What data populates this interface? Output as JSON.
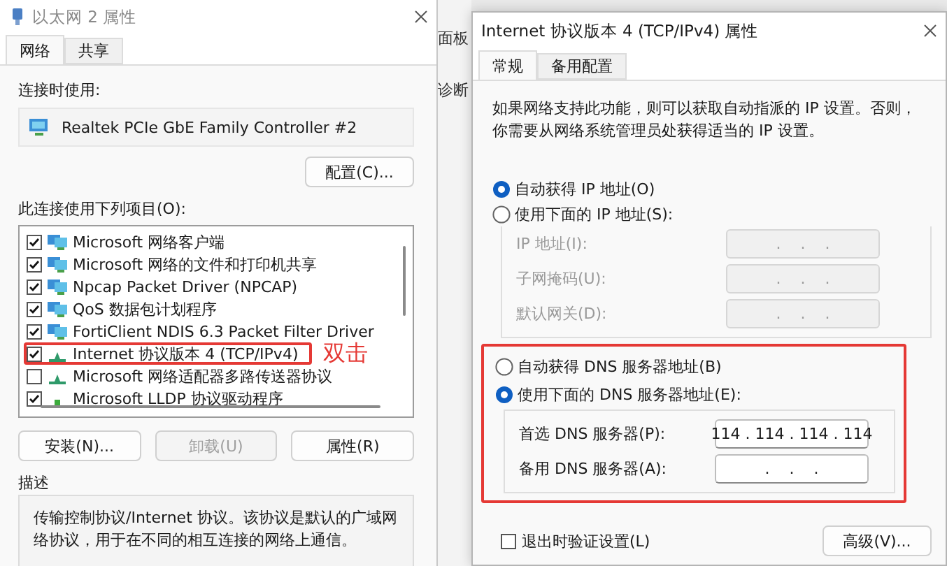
{
  "adapter_dialog": {
    "title": "以太网 2 属性",
    "tabs": [
      {
        "label": "网络",
        "selected": true
      },
      {
        "label": "共享",
        "selected": false
      }
    ],
    "connect_using_label": "连接时使用:",
    "adapter": "Realtek PCIe GbE Family Controller #2",
    "configure_button": "配置(C)...",
    "items_label": "此连接使用下列项目(O):",
    "items": [
      {
        "label": "Microsoft 网络客户端",
        "checked": true,
        "kind": "service",
        "highlighted": false
      },
      {
        "label": "Microsoft 网络的文件和打印机共享",
        "checked": true,
        "kind": "service",
        "highlighted": false
      },
      {
        "label": "Npcap Packet Driver (NPCAP)",
        "checked": true,
        "kind": "service",
        "highlighted": false
      },
      {
        "label": "QoS 数据包计划程序",
        "checked": true,
        "kind": "service",
        "highlighted": false
      },
      {
        "label": "FortiClient NDIS 6.3 Packet Filter Driver",
        "checked": true,
        "kind": "service",
        "highlighted": false
      },
      {
        "label": "Internet 协议版本 4 (TCP/IPv4)",
        "checked": true,
        "kind": "protocol",
        "highlighted": true,
        "annotation": "双击"
      },
      {
        "label": "Microsoft 网络适配器多路传送器协议",
        "checked": false,
        "kind": "protocol",
        "highlighted": false
      },
      {
        "label": "Microsoft LLDP 协议驱动程序",
        "checked": true,
        "kind": "driver",
        "highlighted": false
      }
    ],
    "buttons": [
      {
        "label": "安装(N)...",
        "disabled": false
      },
      {
        "label": "卸载(U)",
        "disabled": true
      },
      {
        "label": "属性(R)",
        "disabled": false
      }
    ],
    "description": {
      "title": "描述",
      "text": "传输控制协议/Internet 协议。该协议是默认的广域网络协议，用于在不同的相互连接的网络上通信。"
    }
  },
  "background_window": {
    "texts": [
      "面板",
      "诊断"
    ]
  },
  "ipv4_dialog": {
    "title": "Internet 协议版本 4 (TCP/IPv4) 属性",
    "tabs": [
      {
        "label": "常规",
        "selected": true
      },
      {
        "label": "备用配置",
        "selected": false
      }
    ],
    "intro": "如果网络支持此功能，则可以获取自动指派的 IP 设置。否则，你需要从网络系统管理员处获得适当的 IP 设置。",
    "ip_modes": [
      {
        "label": "自动获得 IP 地址(O)",
        "selected": true
      },
      {
        "label": "使用下面的 IP 地址(S):",
        "selected": false
      }
    ],
    "ip_fields": [
      {
        "label": "IP 地址(I):",
        "value": ".    .    .",
        "disabled": true
      },
      {
        "label": "子网掩码(U):",
        "value": ".    .    .",
        "disabled": true
      },
      {
        "label": "默认网关(D):",
        "value": ".    .    .",
        "disabled": true
      }
    ],
    "dns_highlighted": true,
    "dns_modes": [
      {
        "label": "自动获得 DNS 服务器地址(B)",
        "selected": false
      },
      {
        "label": "使用下面的 DNS 服务器地址(E):",
        "selected": true
      }
    ],
    "dns_fields": [
      {
        "label": "首选 DNS 服务器(P):",
        "value": "114 . 114 . 114 . 114",
        "disabled": false
      },
      {
        "label": "备用 DNS 服务器(A):",
        "value": ".    .    .",
        "disabled": false
      }
    ],
    "validate": {
      "label": "退出时验证设置(L)",
      "checked": false
    },
    "advanced_button": "高级(V)..."
  }
}
